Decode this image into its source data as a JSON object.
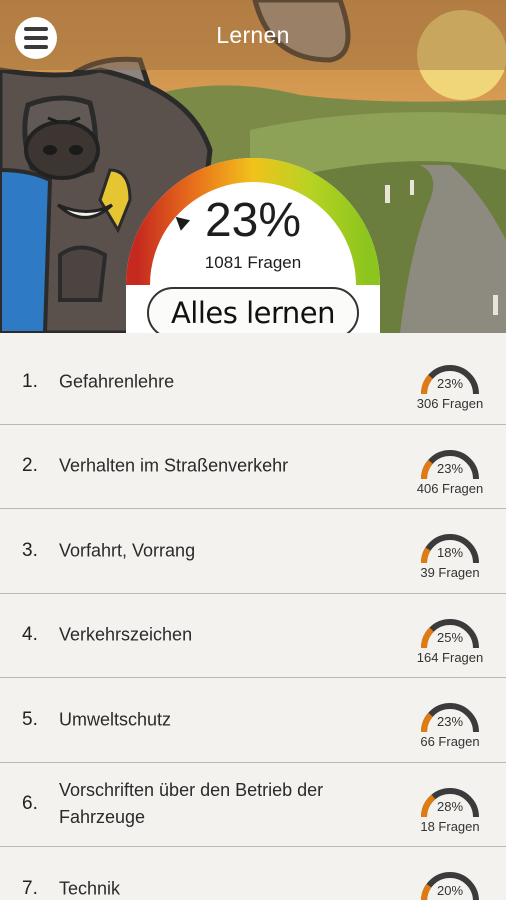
{
  "header": {
    "title": "Lernen"
  },
  "summary": {
    "percent": "23%",
    "percent_value": 0.23,
    "count": "1081 Fragen",
    "learn_all_label": "Alles lernen"
  },
  "categories": [
    {
      "num": "1.",
      "label": "Gefahrenlehre",
      "percent": "23%",
      "value": 0.23,
      "count": "306 Fragen"
    },
    {
      "num": "2.",
      "label": "Verhalten im Straßenverkehr",
      "percent": "23%",
      "value": 0.23,
      "count": "406 Fragen"
    },
    {
      "num": "3.",
      "label": "Vorfahrt, Vorrang",
      "percent": "18%",
      "value": 0.18,
      "count": "39 Fragen"
    },
    {
      "num": "4.",
      "label": "Verkehrszeichen",
      "percent": "25%",
      "value": 0.25,
      "count": "164 Fragen"
    },
    {
      "num": "5.",
      "label": "Umweltschutz",
      "percent": "23%",
      "value": 0.23,
      "count": "66 Fragen"
    },
    {
      "num": "6.",
      "label": "Vorschriften über den Betrieb der Fahrzeuge",
      "percent": "28%",
      "value": 0.28,
      "count": "18 Fragen"
    },
    {
      "num": "7.",
      "label": "Technik",
      "percent": "20%",
      "value": 0.2,
      "count": ""
    }
  ],
  "colors": {
    "gauge_gradient": [
      "#c62a1f",
      "#e9721b",
      "#f1c21b",
      "#b7d323",
      "#8cc51d"
    ],
    "mini_track": "#3b3b3b",
    "mini_fill": "#e07b12"
  }
}
